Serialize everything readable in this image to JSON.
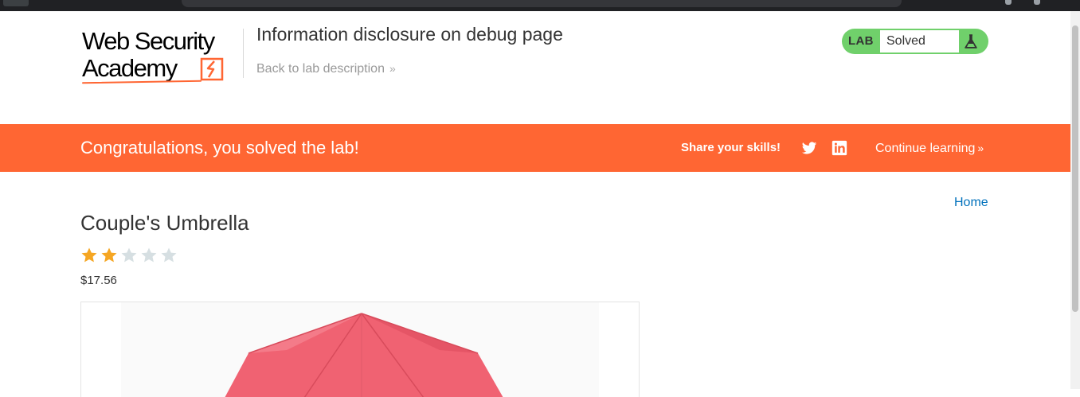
{
  "logo": {
    "line1": "Web Security",
    "line2": "Academy"
  },
  "header": {
    "lab_title": "Information disclosure on debug page",
    "back_link": "Back to lab description",
    "back_chevron": "»"
  },
  "lab_status": {
    "label": "LAB",
    "status": "Solved",
    "icon": "flask-icon"
  },
  "banner": {
    "message": "Congratulations, you solved the lab!",
    "share_label": "Share your skills!",
    "social": [
      "twitter-icon",
      "linkedin-icon"
    ],
    "continue_label": "Continue learning",
    "continue_chevron": "»"
  },
  "nav": {
    "home": "Home"
  },
  "product": {
    "title": "Couple's Umbrella",
    "rating": 2,
    "max_rating": 5,
    "price": "$17.56",
    "image_icon": "umbrella-image"
  },
  "colors": {
    "accent": "#ff6633",
    "solved_green": "#70d06b",
    "star_filled": "#f5a623",
    "star_empty": "#d6dfe2",
    "link": "#0071bc"
  }
}
